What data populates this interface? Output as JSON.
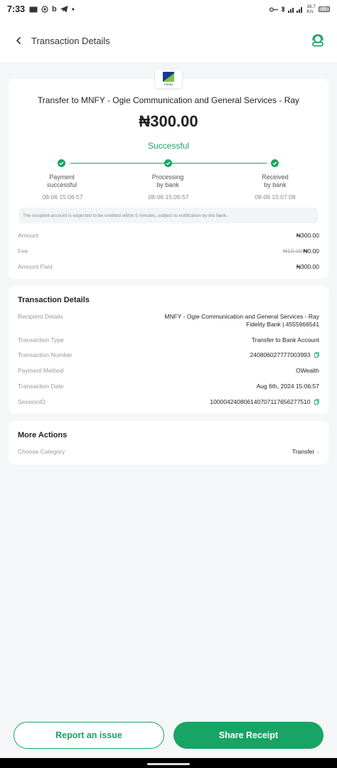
{
  "status_bar": {
    "time": "7:33",
    "left_icons": [
      "sim-icon",
      "circle-icon",
      "b-icon",
      "telegram-icon",
      "dot-icon"
    ],
    "network_speed": "16.7",
    "network_unit": "K/s",
    "battery_level": "91"
  },
  "header": {
    "title": "Transaction Details"
  },
  "summary": {
    "bank_logo_text": "Fidelity",
    "title": "Transfer to MNFY - Ogie Communication and General Services - Ray",
    "amount": "₦300.00",
    "status": "Successful",
    "steps": [
      {
        "label_line1": "Payment",
        "label_line2": "successful",
        "time": "08-06 15:06:57"
      },
      {
        "label_line1": "Processing",
        "label_line2": "by bank",
        "time": "08-06 15:06:57"
      },
      {
        "label_line1": "Received",
        "label_line2": "by bank",
        "time": "08-06 15:07:08"
      }
    ],
    "notice": "The recipient account is expected to be credited within 5 minutes, subject to notification by the bank.",
    "amount_label": "Amount",
    "amount_value": "₦300.00",
    "fee_label": "Fee",
    "fee_original": "₦10.00",
    "fee_value": "₦0.00",
    "amount_paid_label": "Amount Paid",
    "amount_paid_value": "₦300.00"
  },
  "details": {
    "title": "Transaction Details",
    "recipient_label": "Recipient Details",
    "recipient_line1": "MNFY - Ogie Communication and General Services - Ray",
    "recipient_line2": "Fidelity Bank | 4555966541",
    "type_label": "Transaction Type",
    "type_value": "Transfer to Bank Account",
    "number_label": "Transaction Number",
    "number_value": "240806027777003993",
    "method_label": "Payment Method",
    "method_value": "OWealth",
    "date_label": "Transaction Date",
    "date_value": "Aug 6th, 2024 15:06:57",
    "session_label": "SessionID",
    "session_value": "100004240806140707117656277510"
  },
  "more_actions": {
    "title": "More Actions",
    "category_label": "Choose Category",
    "category_value": "Transfer"
  },
  "buttons": {
    "report": "Report an issue",
    "share": "Share Receipt"
  },
  "colors": {
    "accent": "#1aa563",
    "background": "#f5f6f8"
  }
}
